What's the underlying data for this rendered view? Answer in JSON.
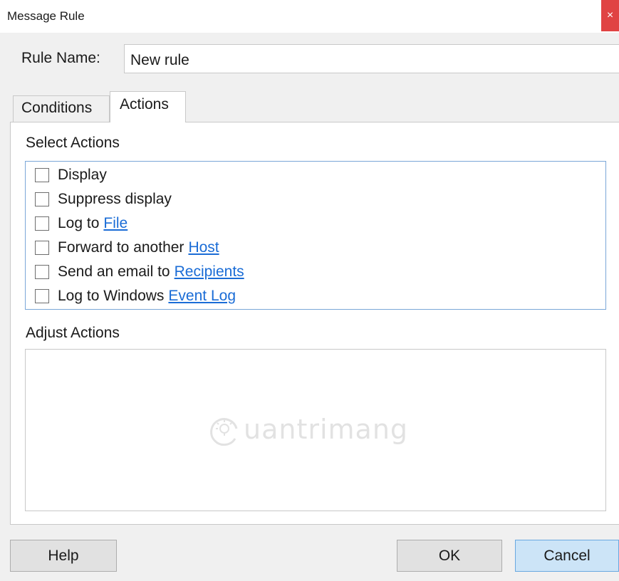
{
  "window": {
    "title": "Message Rule",
    "close_glyph": "×"
  },
  "rule": {
    "label": "Rule Name:",
    "value": "New rule"
  },
  "tabs": [
    {
      "label": "Conditions",
      "selected": false
    },
    {
      "label": "Actions",
      "selected": true
    }
  ],
  "select_actions": {
    "label": "Select Actions",
    "items": [
      {
        "text": "Display",
        "link": "",
        "checked": false
      },
      {
        "text": "Suppress display",
        "link": "",
        "checked": false
      },
      {
        "text": "Log to",
        "link": "File",
        "checked": false
      },
      {
        "text": "Forward to another",
        "link": "Host",
        "checked": false
      },
      {
        "text": "Send an email to",
        "link": "Recipients",
        "checked": false
      },
      {
        "text": "Log to Windows",
        "link": "Event Log",
        "checked": false
      }
    ]
  },
  "adjust_actions": {
    "label": "Adjust Actions"
  },
  "watermark": {
    "text": "uantrimang"
  },
  "buttons": {
    "help": "Help",
    "ok": "OK",
    "cancel": "Cancel"
  },
  "colors": {
    "close_button": "#e04343",
    "link": "#1a6cd6",
    "default_button": "#cce4f7",
    "list_border": "#7aa7d8"
  }
}
